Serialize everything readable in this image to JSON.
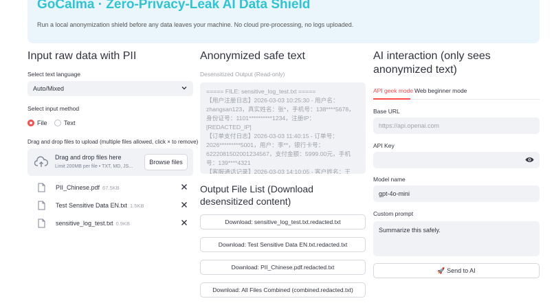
{
  "banner": {
    "title": "GoCalma · Zero-Privacy-Leak AI Data Shield",
    "subtitle": "Run a local anonymization shield before any data leaves your machine. No cloud pre-processing, no logs uploaded."
  },
  "left": {
    "heading": "Input raw data with PII",
    "language_label": "Select text language",
    "language_value": "Auto/Mixed",
    "method_label": "Select input method",
    "method_options": [
      "File",
      "Text"
    ],
    "upload_label": "Drag and drop files to upload (multiple files allowed, click × to remove)",
    "drop_title": "Drag and drop files here",
    "drop_hint": "Limit 200MB per file • TXT, MD, JS...",
    "browse_label": "Browse files",
    "files": [
      {
        "name": "PII_Chinese.pdf",
        "size": "67.5KB"
      },
      {
        "name": "Test Sensitive Data EN.txt",
        "size": "1.5KB"
      },
      {
        "name": "sensitive_log_test.txt",
        "size": "0.9KB"
      }
    ]
  },
  "middle": {
    "heading": "Anonymized safe text",
    "output_label": "Desensitized Output (Read-only)",
    "output_text": "===== FILE: sensitive_log_test.txt =====\n【用户注册日志】2026-03-03 10:25:30 - 用户名：zhangsan123，真实姓名：张*，手机号：138****5678，身份证号：1101**********1234，注册IP：[REDACTED_IP]\n【订单支付日志】2026-03-03 11:40:15 - 订单号：2026*********5001，用户：李**，银行卡号：6222081502001234567，支付金额：5999.00元，手机号：139****4321\n【客服通话记录】2026-03-03 14:10:05 - 客户姓名：王",
    "list_heading": "Output File List (Download desensitized content)",
    "downloads": [
      "Download: sensitive_log_test.txt.redacted.txt",
      "Download: Test Sensitive Data EN.txt.redacted.txt",
      "Download: PII_Chinese.pdf.redacted.txt",
      "Download: All Files Combined (combined.redacted.txt)"
    ]
  },
  "right": {
    "heading": "AI interaction (only sees anonymized text)",
    "tabs": [
      "API geek mode",
      "Web beginner mode"
    ],
    "base_url_label": "Base URL",
    "base_url_placeholder": "https://api.openai.com",
    "api_key_label": "API Key",
    "model_label": "Model name",
    "model_value": "gpt-4o-mini",
    "prompt_label": "Custom prompt",
    "prompt_value": "Summarize this safely.",
    "send_label": "Send to AI",
    "send_icon": "🚀"
  },
  "colors": {
    "accent": "#ff4b4b",
    "brand": "#2ec4d6",
    "banner_bg": "#eaf6fb",
    "input_bg": "#f0f2f6"
  }
}
